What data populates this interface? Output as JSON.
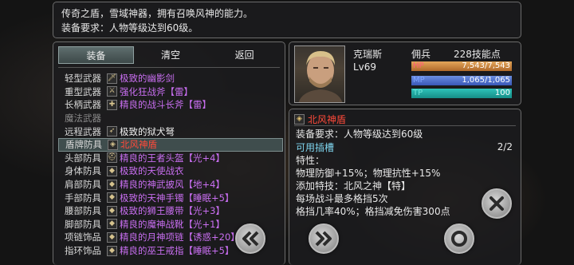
{
  "description": {
    "line1": "传奇之盾，雪域神器，拥有召唤风神的能力。",
    "line2": "装备要求：人物等级达到60级。"
  },
  "tabs": {
    "equip": "装备",
    "clear": "清空",
    "back": "返回"
  },
  "slots": [
    {
      "type": "轻型武器",
      "name": "极致的幽影剑",
      "color": "purple"
    },
    {
      "type": "重型武器",
      "name": "强化狂战斧【雷】",
      "color": "purple"
    },
    {
      "type": "长柄武器",
      "name": "精良的战斗长斧【雷】",
      "color": "purple"
    },
    {
      "type": "魔法武器",
      "name": "",
      "color": "white"
    },
    {
      "type": "远程武器",
      "name": "极致的狱犬弩",
      "color": "white"
    },
    {
      "type": "盾牌防具",
      "name": "北风神盾",
      "color": "red"
    },
    {
      "type": "头部防具",
      "name": "精良的王者头盔【光+4】",
      "color": "purple"
    },
    {
      "type": "身体防具",
      "name": "极致的天使战衣",
      "color": "purple"
    },
    {
      "type": "肩部防具",
      "name": "精良的神武披风【地+4】",
      "color": "purple"
    },
    {
      "type": "手部防具",
      "name": "极致的天神手镯【睡眠+5】",
      "color": "purple"
    },
    {
      "type": "腰部防具",
      "name": "极致的狮王腰带【光+3】",
      "color": "purple"
    },
    {
      "type": "脚部防具",
      "name": "精良的魔神战靴【光+1】",
      "color": "purple"
    },
    {
      "type": "项链饰品",
      "name": "精良的月神项链【诱惑+20】",
      "color": "purple"
    },
    {
      "type": "指环饰品",
      "name": "精良的巫王戒指【睡眠+5】",
      "color": "purple"
    }
  ],
  "character": {
    "name": "克瑞斯",
    "level": "Lv69",
    "class": "佣兵",
    "skill_points": "228技能点",
    "hp": {
      "label": "HP",
      "value": "7,543/7,543",
      "fraction": 1.0
    },
    "mp": {
      "label": "MP",
      "value": "1,065/1,065",
      "fraction": 1.0
    },
    "tp": {
      "label": "TP",
      "value": "100",
      "fraction": 1.0
    }
  },
  "detail": {
    "item_name": "北风神盾",
    "requirement": "装备要求：人物等级达到60级",
    "inlay_label": "可用插槽",
    "inlay_count": "2/2",
    "attr_title": "特性：",
    "attr1": "物理防御+15%；物理抗性+15%",
    "attr2": "添加特技：北风之神【特】",
    "attr3": "每场战斗最多格挡5次",
    "attr4": "格挡几率40%；格挡减免伤害300点"
  },
  "buttons": {
    "close": "close-icon",
    "prev": "double-chevron-left-icon",
    "next": "double-chevron-right-icon",
    "confirm": "ring-icon"
  },
  "colors": {
    "purple": "#c86ef0",
    "red": "#ff4a3a",
    "white": "#f0f0f0",
    "cyan": "#7fd6f0"
  }
}
